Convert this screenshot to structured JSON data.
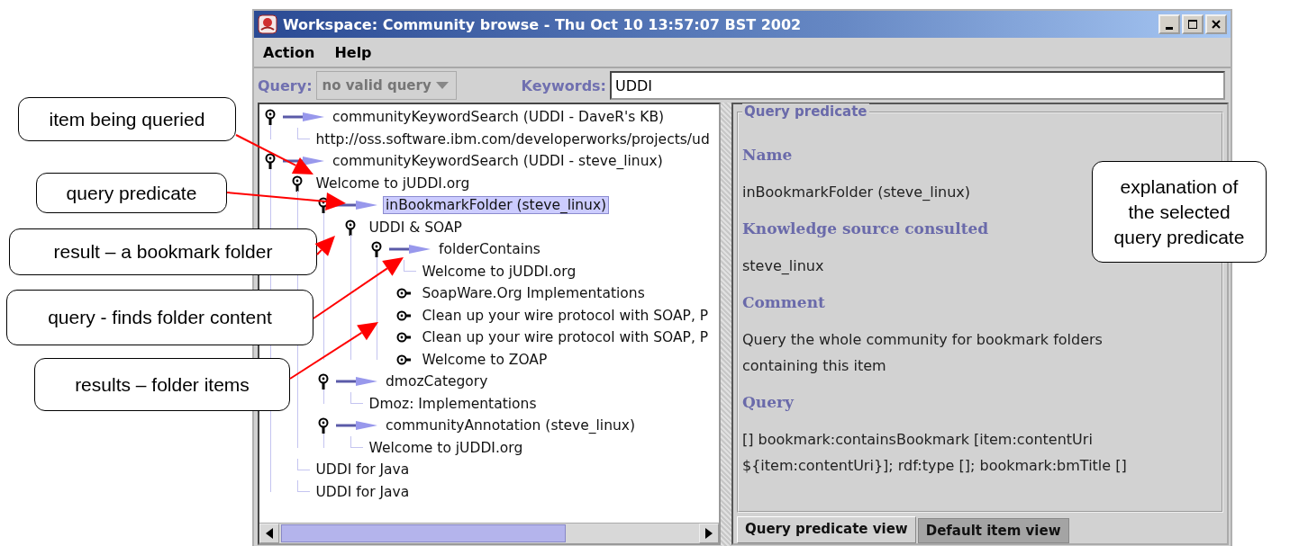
{
  "window": {
    "title": "Workspace: Community browse - Thu Oct 10 13:57:07 BST 2002"
  },
  "menu": [
    "Action",
    "Help"
  ],
  "query_bar": {
    "query_label": "Query:",
    "query_combo": {
      "value": "no valid query",
      "disabled": true
    },
    "keywords_label": "Keywords:",
    "keywords_field": {
      "value": "UDDI"
    }
  },
  "tree": [
    {
      "kind": "query",
      "label": "communityKeywordSearch (UDDI - DaveR's KB)",
      "expanded": true,
      "selected": false,
      "children": [
        {
          "kind": "leaf",
          "label": "http://oss.software.ibm.com/developerworks/projects/ud",
          "selected": false
        }
      ]
    },
    {
      "kind": "query",
      "label": "communityKeywordSearch (UDDI - steve_linux)",
      "expanded": true,
      "selected": false,
      "children": [
        {
          "kind": "item",
          "label": "Welcome to jUDDI.org",
          "expanded": true,
          "selected": false,
          "children": [
            {
              "kind": "query",
              "label": "inBookmarkFolder (steve_linux)",
              "expanded": true,
              "selected": true,
              "children": [
                {
                  "kind": "item",
                  "label": "UDDI & SOAP",
                  "expanded": true,
                  "selected": false,
                  "children": [
                    {
                      "kind": "query",
                      "label": "folderContains",
                      "expanded": true,
                      "selected": false,
                      "children": [
                        {
                          "kind": "leaf",
                          "label": "Welcome to jUDDI.org",
                          "selected": false
                        },
                        {
                          "kind": "item",
                          "label": "SoapWare.Org  Implementations",
                          "expanded": false,
                          "selected": false
                        },
                        {
                          "kind": "item",
                          "label": "Clean up your wire protocol with SOAP, P",
                          "expanded": false,
                          "selected": false
                        },
                        {
                          "kind": "item",
                          "label": "Clean up your wire protocol with SOAP, P",
                          "expanded": false,
                          "selected": false
                        },
                        {
                          "kind": "item",
                          "label": "Welcome to ZOAP",
                          "expanded": false,
                          "selected": false
                        }
                      ]
                    }
                  ]
                }
              ]
            },
            {
              "kind": "query",
              "label": "dmozCategory",
              "expanded": true,
              "selected": false,
              "children": [
                {
                  "kind": "leaf",
                  "label": "Dmoz: Implementations",
                  "selected": false
                }
              ]
            },
            {
              "kind": "query",
              "label": "communityAnnotation (steve_linux)",
              "expanded": true,
              "selected": false,
              "children": [
                {
                  "kind": "leaf",
                  "label": "Welcome to jUDDI.org",
                  "selected": false
                }
              ]
            }
          ]
        },
        {
          "kind": "leaf",
          "label": "UDDI for Java",
          "selected": false
        },
        {
          "kind": "leaf",
          "label": "UDDI for Java",
          "selected": false
        }
      ]
    }
  ],
  "detail": {
    "group_title": "Query predicate",
    "sections": [
      {
        "heading": "Name",
        "body": "inBookmarkFolder (steve_linux)"
      },
      {
        "heading": "Knowledge source consulted",
        "body": "steve_linux"
      },
      {
        "heading": "Comment",
        "body": "Query the whole community for bookmark folders containing this item"
      },
      {
        "heading": "Query",
        "body": "[] bookmark:containsBookmark [item:contentUri ${item:contentUri}]; rdf:type []; bookmark:bmTitle []"
      }
    ]
  },
  "tabs": [
    {
      "label": "Query predicate view",
      "selected": true
    },
    {
      "label": "Default item view",
      "selected": false
    }
  ],
  "annotations": [
    {
      "text": "item being queried"
    },
    {
      "text": "query predicate"
    },
    {
      "text": "result – a bookmark folder"
    },
    {
      "text": "query  - finds folder content"
    },
    {
      "text": "results – folder items"
    },
    {
      "text": "explanation of the selected query predicate"
    }
  ]
}
